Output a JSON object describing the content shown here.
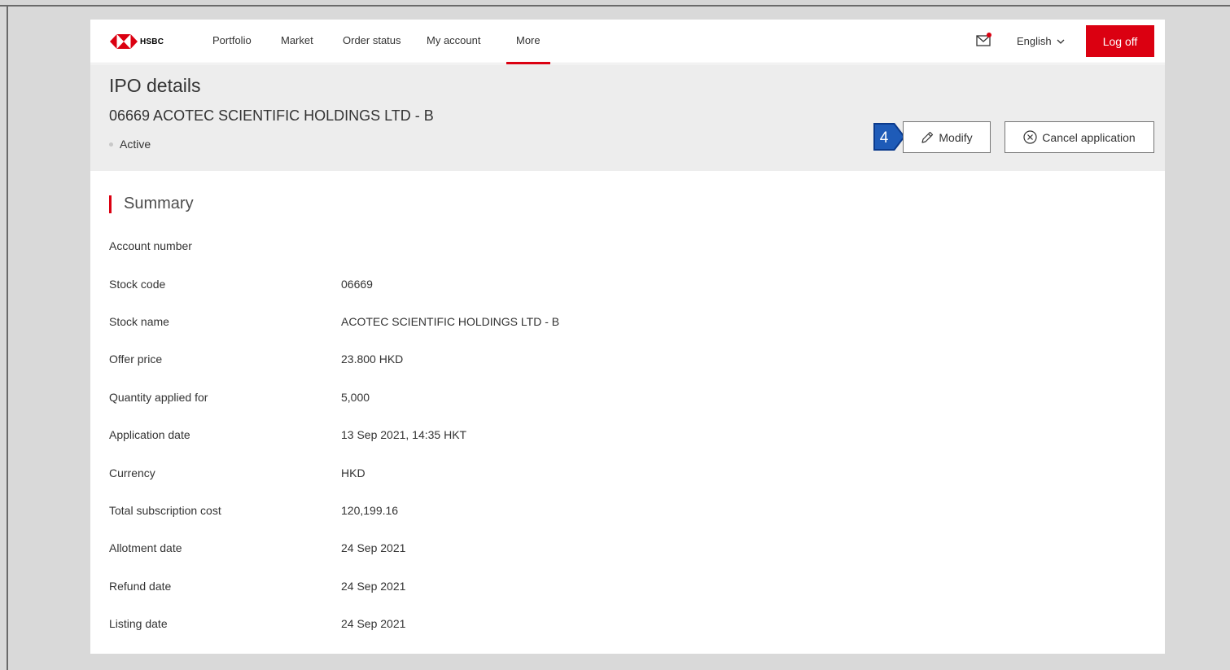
{
  "brand": {
    "name": "HSBC",
    "accent": "#db0011"
  },
  "nav": {
    "items": [
      {
        "label": "Portfolio"
      },
      {
        "label": "Market"
      },
      {
        "label": "Order status"
      },
      {
        "label": "My account"
      },
      {
        "label": "More"
      }
    ],
    "active": "More",
    "mail_icon": "mail-icon",
    "language": "English",
    "logoff": "Log off"
  },
  "header": {
    "title": "IPO details",
    "subtitle": "06669 ACOTEC SCIENTIFIC HOLDINGS LTD - B",
    "status": "Active",
    "modify": "Modify",
    "cancel": "Cancel application",
    "callout": "4"
  },
  "summary": {
    "title": "Summary",
    "rows": [
      {
        "label": "Account number",
        "value": ""
      },
      {
        "label": "Stock code",
        "value": "06669"
      },
      {
        "label": "Stock name",
        "value": "ACOTEC SCIENTIFIC HOLDINGS LTD - B"
      },
      {
        "label": "Offer price",
        "value": "23.800 HKD"
      },
      {
        "label": "Quantity applied for",
        "value": "5,000"
      },
      {
        "label": "Application date",
        "value": "13 Sep 2021, 14:35 HKT"
      },
      {
        "label": "Currency",
        "value": "HKD"
      },
      {
        "label": "Total subscription cost",
        "value": "120,199.16"
      },
      {
        "label": "Allotment date",
        "value": "24 Sep 2021"
      },
      {
        "label": "Refund date",
        "value": "24 Sep 2021"
      },
      {
        "label": "Listing date",
        "value": "24 Sep 2021"
      }
    ]
  }
}
